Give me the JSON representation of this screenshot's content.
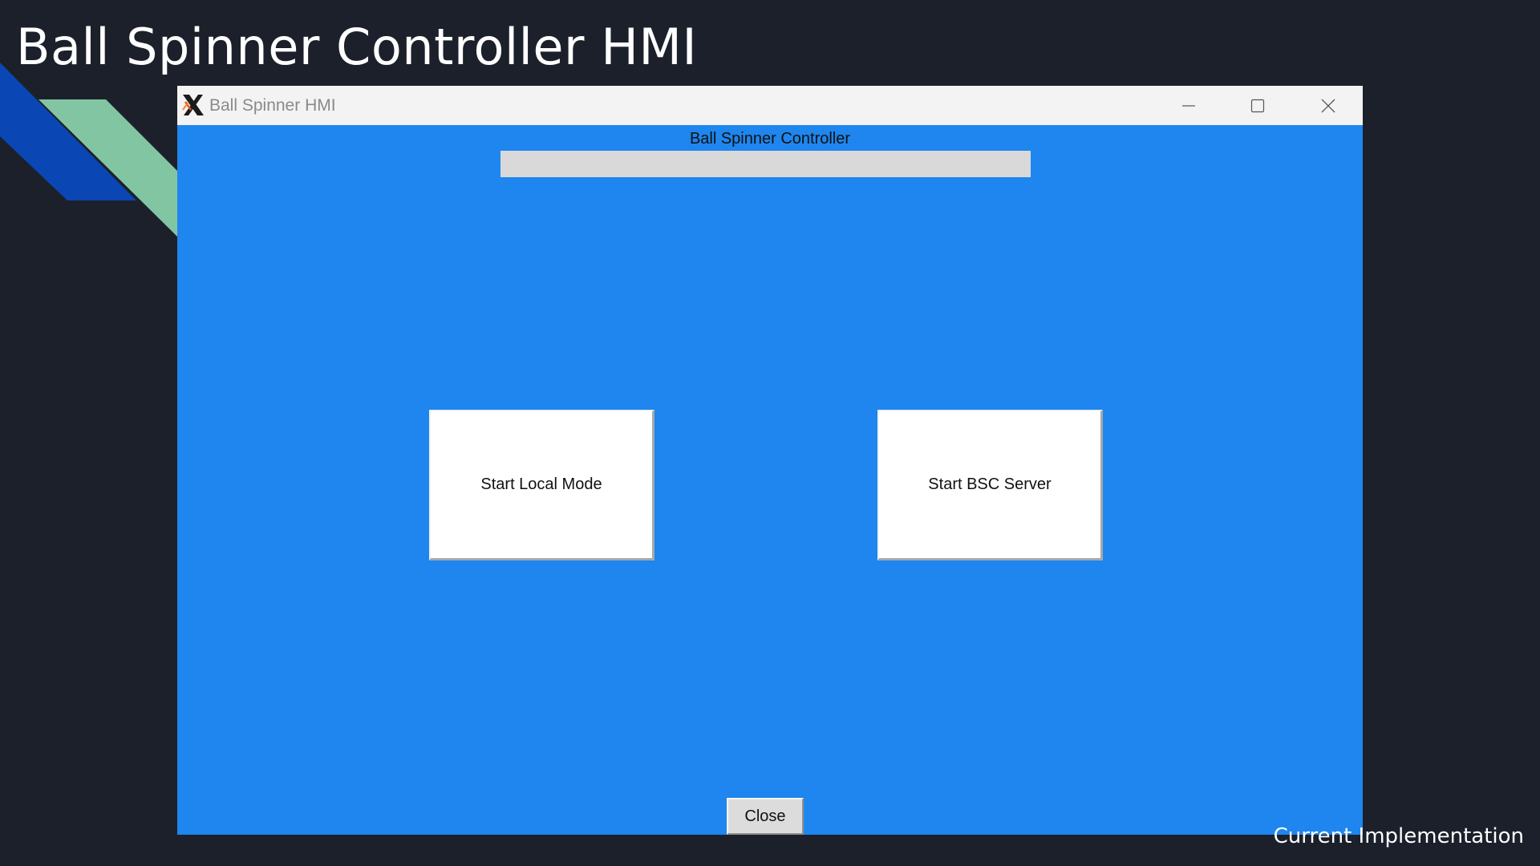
{
  "slide": {
    "title": "Ball Spinner Controller HMI",
    "footer_caption": "Current Implementation"
  },
  "window": {
    "title": "Ball Spinner HMI",
    "app_icon": "x-window-system-icon",
    "controls": {
      "minimize_icon": "minimize-icon",
      "maximize_icon": "maximize-icon",
      "close_icon": "close-icon"
    }
  },
  "main": {
    "heading": "Ball Spinner Controller",
    "status_field": {
      "value": ""
    },
    "buttons": {
      "local_mode": "Start Local Mode",
      "bsc_server": "Start BSC Server",
      "close": "Close"
    }
  },
  "colors": {
    "slide_background": "#1c202b",
    "window_background": "#1e86ee",
    "titlebar": "#f3f3f3",
    "deco_blue": "#0a47b5",
    "deco_green": "#82c5a3"
  }
}
